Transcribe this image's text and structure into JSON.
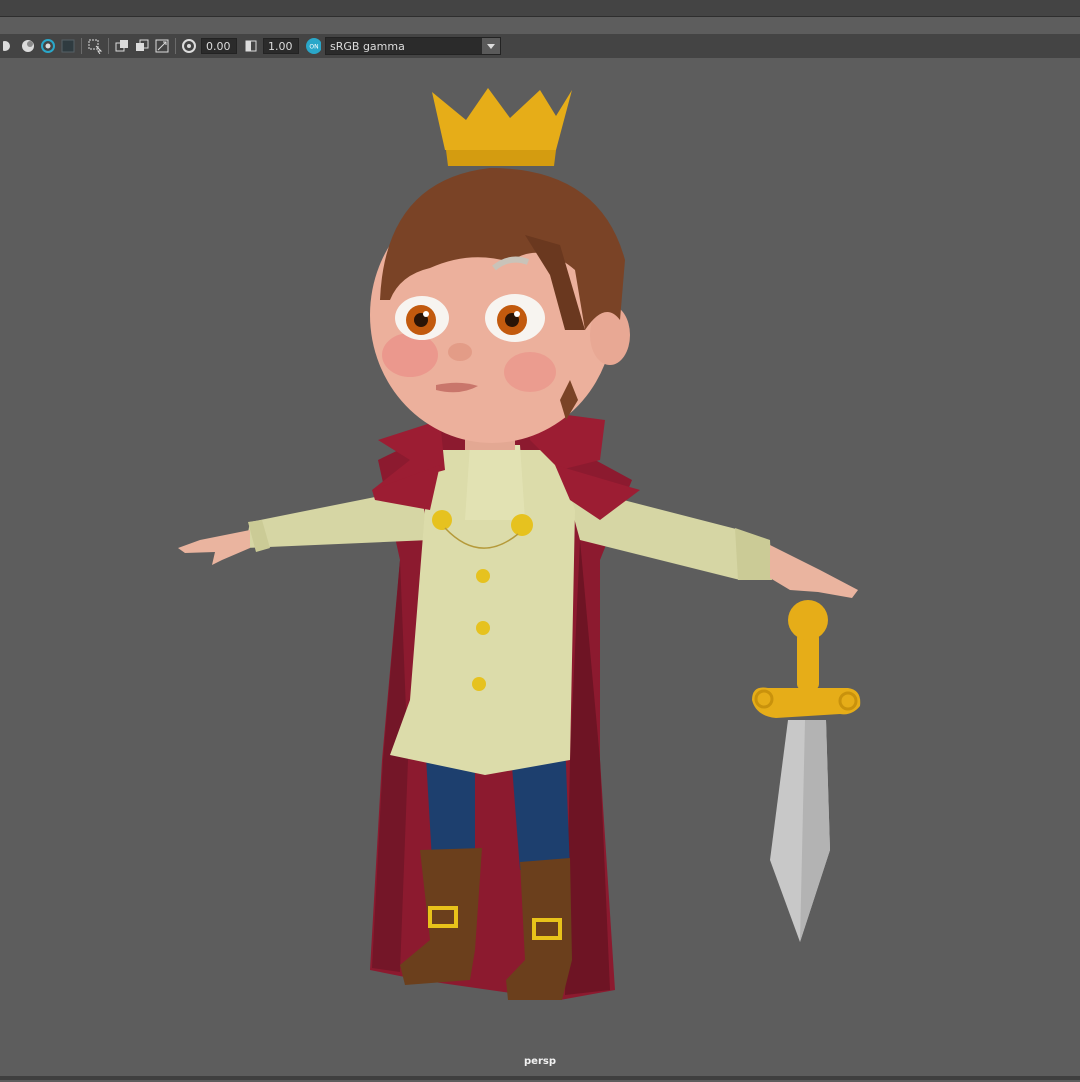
{
  "toolbar": {
    "exposure_value": "0.00",
    "gamma_value": "1.00",
    "color_space": "sRGB gamma",
    "colorspace_toggle_badge": "ON"
  },
  "viewport": {
    "camera_label": "persp"
  },
  "colors": {
    "viewport_bg": "#5d5d5d",
    "toolbar_bg": "#444444",
    "accent_blue": "#2aa7c9"
  }
}
